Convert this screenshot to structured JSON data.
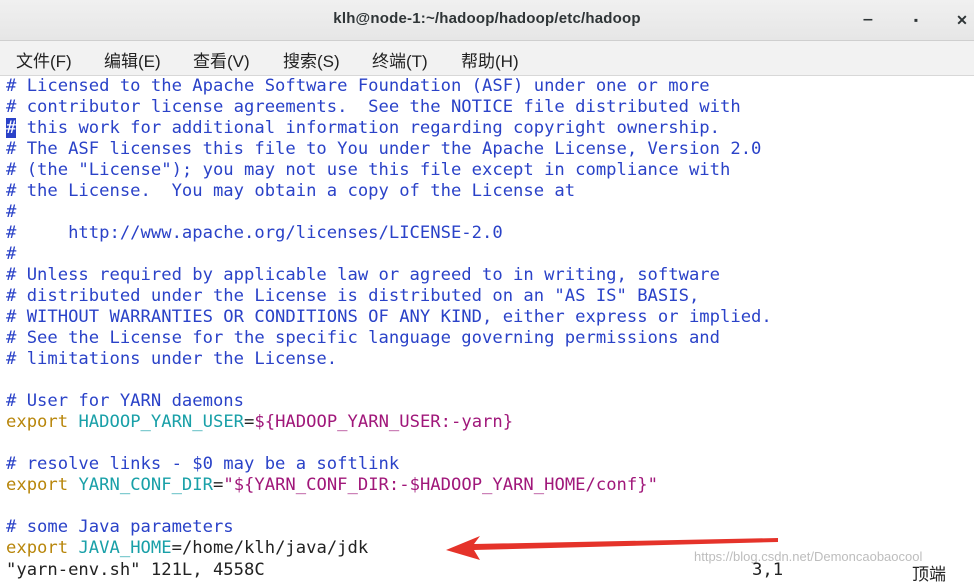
{
  "window": {
    "title": "klh@node-1:~/hadoop/hadoop/etc/hadoop",
    "minimize": "‒",
    "maximize": "▪",
    "close": "✕"
  },
  "menu": {
    "file": "文件(F)",
    "edit": "编辑(E)",
    "view": "查看(V)",
    "search": "搜索(S)",
    "terminal": "终端(T)",
    "help": "帮助(H)"
  },
  "lines": {
    "l1": "# Licensed to the Apache Software Foundation (ASF) under one or more",
    "l2": "# contributor license agreements.  See the NOTICE file distributed with",
    "l3_cursor": "#",
    "l3_rest": " this work for additional information regarding copyright ownership.",
    "l4": "# The ASF licenses this file to You under the Apache License, Version 2.0",
    "l5": "# (the \"License\"); you may not use this file except in compliance with",
    "l6": "# the License.  You may obtain a copy of the License at",
    "l7": "#",
    "l8": "#     http://www.apache.org/licenses/LICENSE-2.0",
    "l9": "#",
    "l10": "# Unless required by applicable law or agreed to in writing, software",
    "l11": "# distributed under the License is distributed on an \"AS IS\" BASIS,",
    "l12": "# WITHOUT WARRANTIES OR CONDITIONS OF ANY KIND, either express or implied.",
    "l13": "# See the License for the specific language governing permissions and",
    "l14": "# limitations under the License.",
    "l16": "# User for YARN daemons",
    "l17_kw": "export",
    "l17_var": "HADOOP_YARN_USER",
    "l17_eq": "=",
    "l17_val": "${HADOOP_YARN_USER:-yarn}",
    "l19": "# resolve links - $0 may be a softlink",
    "l20_kw": "export",
    "l20_var": "YARN_CONF_DIR",
    "l20_eq": "=",
    "l20_val": "\"${YARN_CONF_DIR:-$HADOOP_YARN_HOME/conf}\"",
    "l22": "# some Java parameters",
    "l23_kw": "export",
    "l23_var": "JAVA_HOME",
    "l23_eq": "=",
    "l23_val": "/home/klh/java/jdk"
  },
  "status": {
    "file": "\"yarn-env.sh\" 121L, 4558C",
    "cursor_pos": "3,1",
    "scroll": "顶端"
  },
  "watermark": "https://blog.csdn.net/Demoncaobaocool",
  "colors": {
    "comment": "#2a42c8",
    "keyword": "#b8860b",
    "variable": "#19a0a8",
    "value": "#a0177a",
    "arrow": "#e5332a"
  },
  "icons": {
    "annotation_arrow": "red-arrow-icon"
  }
}
